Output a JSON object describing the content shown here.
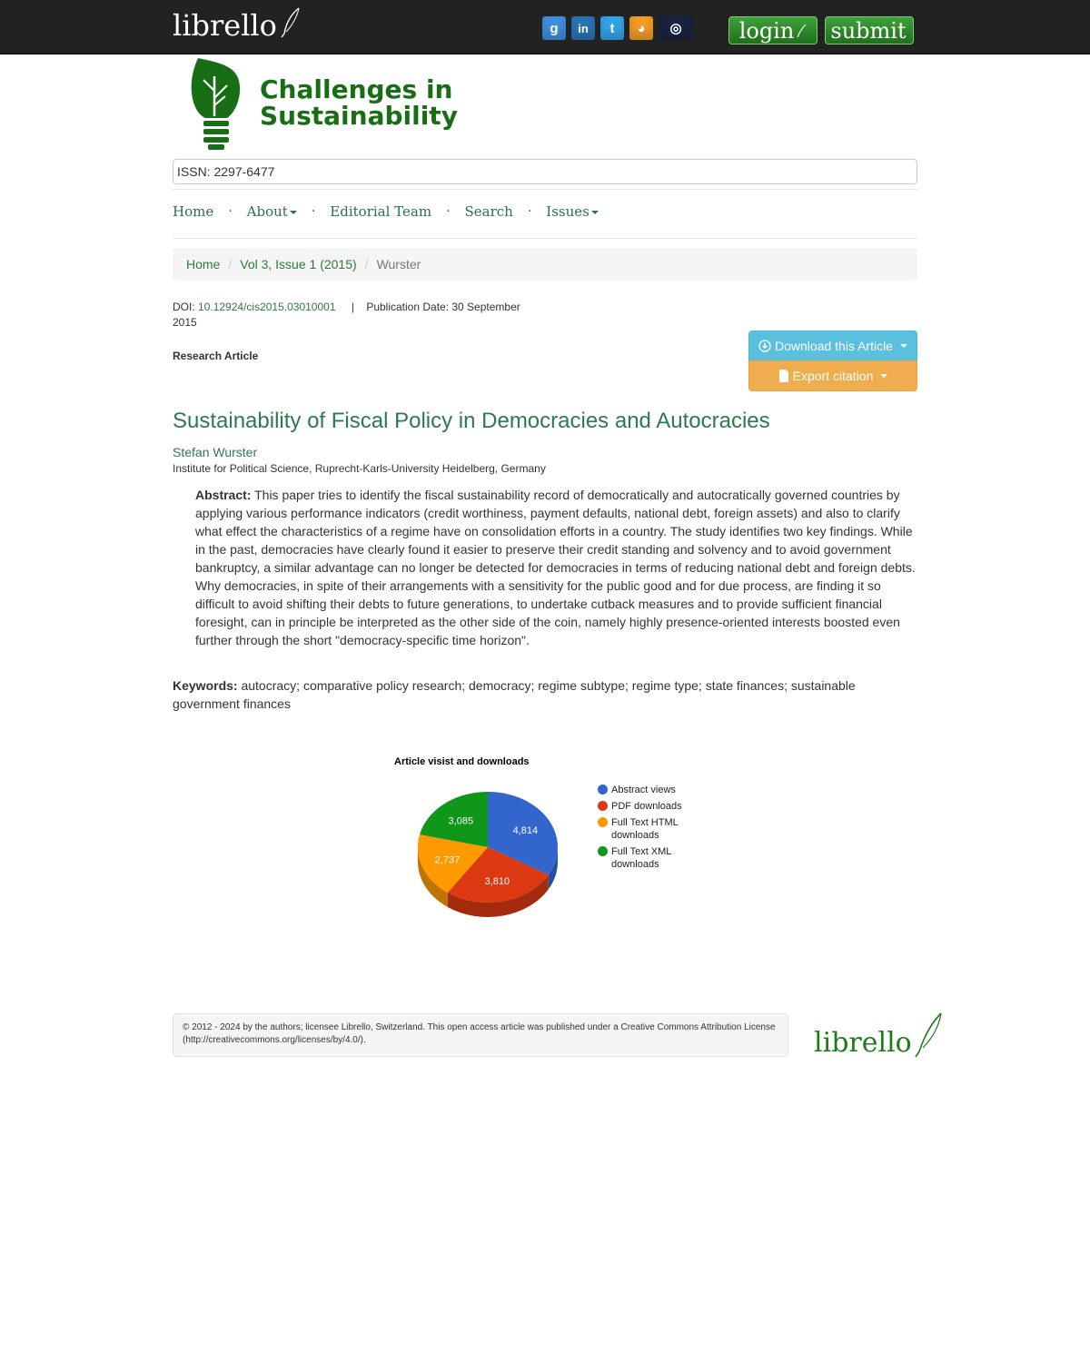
{
  "topbar": {
    "brand": "librello",
    "socials": [
      {
        "name": "google",
        "glyph": "g"
      },
      {
        "name": "linkedin",
        "glyph": "in"
      },
      {
        "name": "twitter",
        "glyph": "t"
      },
      {
        "name": "rss",
        "glyph": "◕"
      },
      {
        "name": "archive",
        "glyph": "◎"
      }
    ],
    "login_label": "login",
    "submit_label": "submit"
  },
  "journal": {
    "title_line1": "Challenges in",
    "title_line2": "Sustainability",
    "issn": "ISSN: 2297-6477",
    "brand_color": "#176e14"
  },
  "nav": {
    "items": [
      "Home",
      "About",
      "Editorial Team",
      "Search",
      "Issues"
    ],
    "separator": "·"
  },
  "breadcrumb": {
    "home": "Home",
    "issue": "Vol 3, Issue 1 (2015)",
    "current": "Wurster",
    "separator": "/"
  },
  "article": {
    "doi_label": "DOI:",
    "doi": "10.12924/cis2015.03010001",
    "pipe": "|",
    "pub_date": "Publication Date: 30 September 2015",
    "type": "Research Article",
    "download_label": "Download this Article",
    "export_label": "Export citation",
    "title": "Sustainability of Fiscal Policy in Democracies and Autocracies",
    "author": "Stefan Wurster",
    "affiliation": "Institute for Political Science, Ruprecht-Karls-University Heidelberg, Germany",
    "abstract_label": "Abstract:",
    "abstract": "This paper tries to identify the fiscal sustainability record of democratically and autocratically governed countries by applying various performance indicators (credit worthiness, payment defaults, national debt, foreign assets) and also to clarify what effect the characteristics of a regime have on consolidation efforts in a country. The study identifies two key findings. While in the past, democracies have clearly found it easier to preserve their credit standing and solvency and to avoid government bankruptcy, a similar advantage can no longer be detected for democracies in terms of reducing national debt and foreign debts. Why democracies, in spite of their arrangements with a sensitivity for the public good and for due process, are finding it so difficult to avoid shifting their debts to future generations, to undertake cutback measures and to provide sufficient financial foresight, can in principle be interpreted as the other side of the coin, namely highly presence-oriented interests boosted even further through the short \"democracy-specific time horizon\".",
    "keywords_label": "Keywords:",
    "keywords": "autocracy; comparative policy research; democracy; regime subtype; regime type; state finances; sustainable government finances"
  },
  "chart_data": {
    "type": "pie",
    "title": "Article visist and downloads",
    "categories": [
      "Abstract views",
      "PDF downloads",
      "Full Text HTML downloads",
      "Full Text XML downloads"
    ],
    "values": [
      4814,
      3810,
      2737,
      3085
    ],
    "value_labels": [
      "4,814",
      "3,810",
      "2,737",
      "3,085"
    ],
    "colors": [
      "#3366cc",
      "#dc3912",
      "#ff9900",
      "#109618"
    ],
    "style": "3d",
    "legend_position": "right"
  },
  "footer": {
    "copyright": "2012 - 2024 by the authors; licensee Librello, Switzerland. This open access article was published under a Creative Commons Attribution License (http://creativecommons.org/licenses/by/4.0/).",
    "logo_text": "librello"
  }
}
